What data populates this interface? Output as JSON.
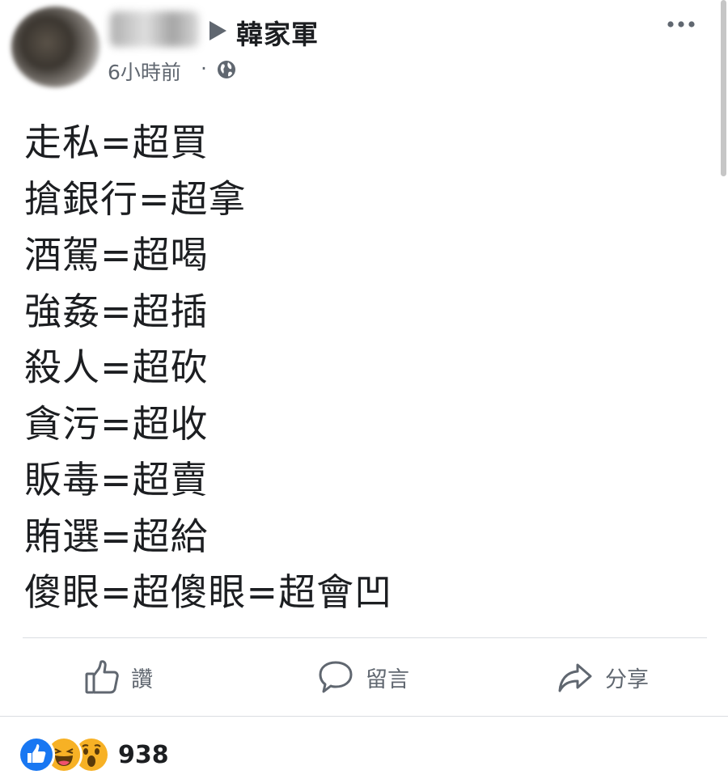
{
  "header": {
    "group_name": "韓家軍",
    "timestamp": "6小時前",
    "separator": "·",
    "icons": {
      "arrow": "triangle-right-icon",
      "privacy": "globe-icon",
      "more": "more-dots-icon"
    }
  },
  "post": {
    "lines": [
      "走私=超買",
      "搶銀行=超拿",
      "酒駕=超喝",
      "強姦=超插",
      "殺人=超砍",
      "貪污=超收",
      "販毒=超賣",
      "賄選=超給",
      "傻眼=超傻眼=超會凹"
    ]
  },
  "actions": {
    "like_label": "讚",
    "comment_label": "留言",
    "share_label": "分享"
  },
  "reactions": {
    "count": "938",
    "types": [
      "like-reaction-icon",
      "haha-reaction-icon",
      "wow-reaction-icon"
    ]
  },
  "colors": {
    "text": "#1c1e21",
    "secondary": "#606770",
    "like_blue": "#1877f2",
    "reaction_yellow": "#f7b125",
    "divider": "#dadde1"
  }
}
